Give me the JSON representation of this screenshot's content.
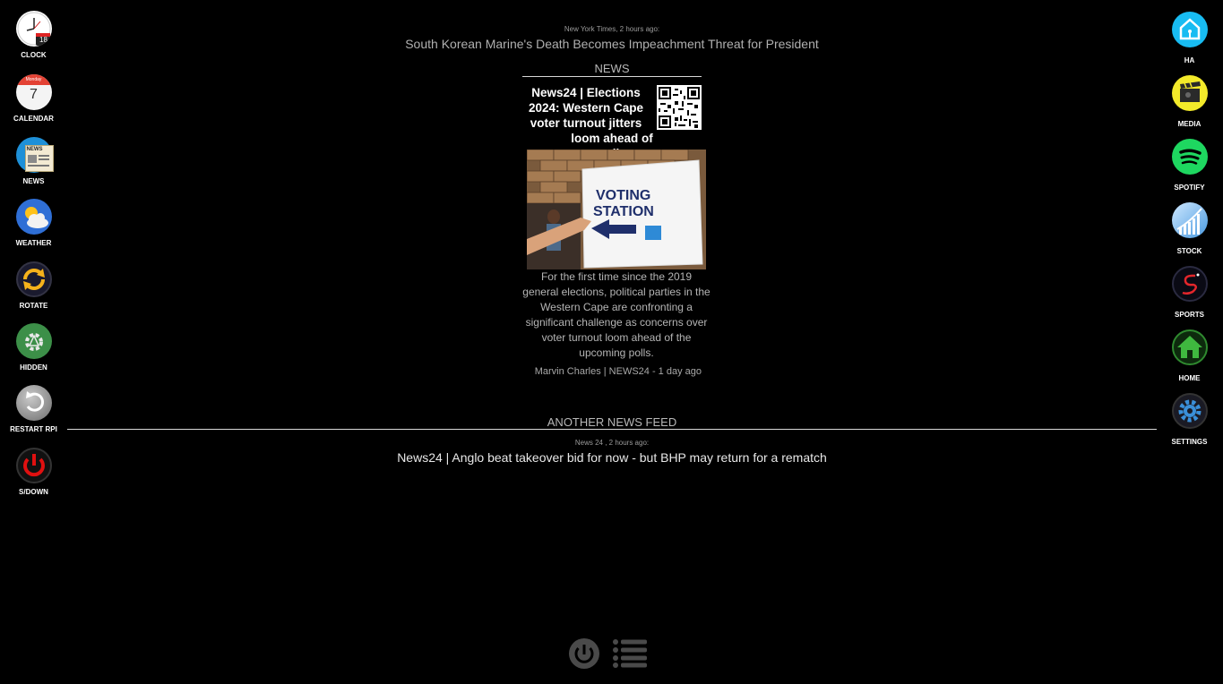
{
  "left_apps": [
    {
      "label": "CLOCK",
      "icon": "clock-icon"
    },
    {
      "label": "CALENDAR",
      "icon": "calendar-icon",
      "date_num": "7",
      "date_day": "Monday"
    },
    {
      "label": "NEWS",
      "icon": "newspaper-icon"
    },
    {
      "label": "WEATHER",
      "icon": "weather-icon"
    },
    {
      "label": "ROTATE",
      "icon": "rotate-icon"
    },
    {
      "label": "HIDDEN",
      "icon": "hidden-icon"
    },
    {
      "label": "RESTART RPI",
      "icon": "restart-icon"
    },
    {
      "label": "S/DOWN",
      "icon": "shutdown-icon"
    }
  ],
  "right_apps": [
    {
      "label": "HA",
      "icon": "home-assistant-icon"
    },
    {
      "label": "MEDIA",
      "icon": "media-icon"
    },
    {
      "label": "SPOTIFY",
      "icon": "spotify-icon"
    },
    {
      "label": "STOCK",
      "icon": "stock-icon"
    },
    {
      "label": "SPORTS",
      "icon": "sports-icon"
    },
    {
      "label": "HOME",
      "icon": "home-icon"
    },
    {
      "label": "SETTINGS",
      "icon": "settings-icon"
    }
  ],
  "clock_badge": "18",
  "news_badge": "NEWS",
  "ticker": {
    "meta": "New York Times, 2 hours ago:",
    "title": "South Korean Marine's Death Becomes Impeachment Threat for President"
  },
  "news": {
    "heading": "NEWS",
    "title_line1": "News24 | Elections 2024: Western Cape voter turnout jitters",
    "title_line2": "loom ahead of polls",
    "image_text_1": "VOTING",
    "image_text_2": "STATION",
    "summary": "For the first time since the 2019 general elections, political parties in the Western Cape are confronting a significant challenge as concerns over voter turnout loom ahead of the upcoming polls.",
    "byline": "Marvin Charles | NEWS24 - 1 day ago"
  },
  "feed": {
    "heading": "ANOTHER NEWS FEED",
    "meta": "News 24 , 2 hours ago:",
    "title": "News24 | Anglo beat takeover bid for now - but BHP may return for a rematch"
  },
  "colors": {
    "background": "#000000",
    "spotify": "#1ed760",
    "ha": "#18bcf2",
    "hidden": "#3c8f48",
    "shutdown": "#d90f0f"
  }
}
